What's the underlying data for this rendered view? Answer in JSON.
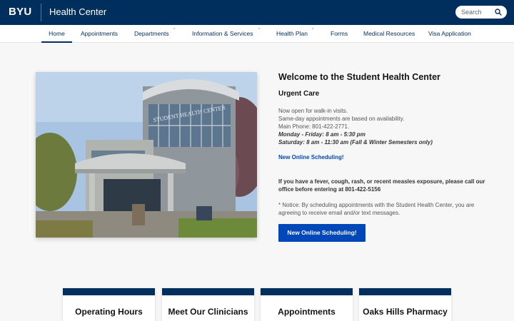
{
  "header": {
    "logo": "BYU",
    "site_title": "Health Center",
    "search_placeholder": "Search"
  },
  "nav": {
    "items": [
      {
        "label": "Home",
        "active": true
      },
      {
        "label": "Appointments"
      },
      {
        "label": "Departments",
        "has_dropdown": true
      },
      {
        "label": "Information & Services",
        "has_dropdown": true
      },
      {
        "label": "Health Plan",
        "has_dropdown": true
      },
      {
        "label": "Forms"
      },
      {
        "label": "Medical Resources"
      },
      {
        "label": "Visa Application"
      }
    ]
  },
  "main": {
    "image_sign": "STUDENT HEALTH CENTER",
    "welcome_title": "Welcome to the Student Health Center",
    "urgent_title": "Urgent Care",
    "lines": [
      "Now open for walk-in visits.",
      "Same-day appointments are based on availability.",
      "Main Phone: 801-422-2771."
    ],
    "hours_weekday": "Monday - Friday: 8 am - 5:30 pm",
    "hours_saturday": "Saturday: 8 am - 11:30 am (Fall & Winter Semesters only)",
    "sched_link": "New Online Scheduling!",
    "fever_notice": "If you have a fever, cough, rash, or recent measles exposure, please call our office before entering at 801-422-5156",
    "notice": "* Notice: By scheduling appointments with the Student Health Center, you are agreeing to receive email and/or text messages.",
    "sched_button": "New Online Scheduling!"
  },
  "cards": [
    {
      "title": "Operating Hours"
    },
    {
      "title": "Meet Our Clinicians"
    },
    {
      "title": "Appointments"
    },
    {
      "title": "Oaks Hills Pharmacy"
    }
  ],
  "colors": {
    "brand_navy": "#002e5d",
    "link_blue": "#0047ba",
    "page_bg": "#f7f7f7"
  }
}
